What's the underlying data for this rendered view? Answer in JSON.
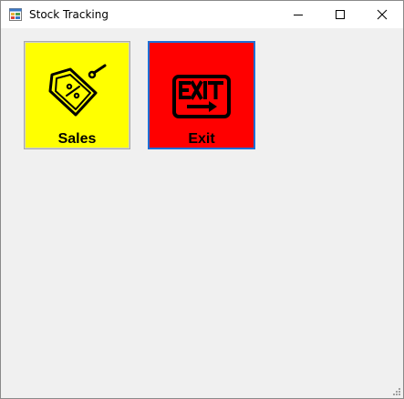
{
  "window": {
    "title": "Stock Tracking",
    "controls": {
      "minimize_icon": "minimize-icon",
      "maximize_icon": "maximize-icon",
      "close_icon": "close-icon"
    }
  },
  "tiles": [
    {
      "label": "Sales",
      "icon": "price-tag-percent-icon",
      "color": "#ffff00"
    },
    {
      "label": "Exit",
      "icon": "exit-sign-icon",
      "color": "#ff0000"
    }
  ],
  "colors": {
    "focus_border": "#1e6fd6",
    "client_background": "#f0f0f0"
  }
}
